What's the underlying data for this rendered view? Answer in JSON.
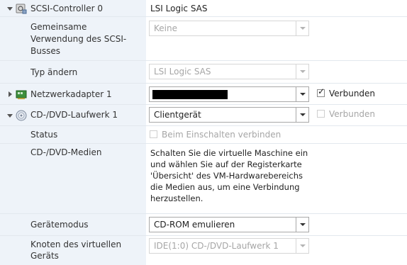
{
  "rows": {
    "scsi_controller": {
      "label": "SCSI-Controller 0",
      "value": "LSI Logic SAS"
    },
    "bus_sharing": {
      "label_lines": [
        "Gemeinsame",
        "Verwendung des SCSI-",
        "Busses"
      ],
      "select_value": "Keine"
    },
    "change_type": {
      "label": "Typ ändern",
      "select_value": "LSI Logic SAS"
    },
    "network_adapter": {
      "label": "Netzwerkadapter 1",
      "select_value": "",
      "connected_label": "Verbunden",
      "connected_checked": true
    },
    "cd_dvd_drive": {
      "label": "CD-/DVD-Laufwerk 1",
      "select_value": "Clientgerät",
      "connected_label": "Verbunden",
      "connected_checked": false
    },
    "status": {
      "label": "Status",
      "checkbox_label": "Beim Einschalten verbinden",
      "checked": false
    },
    "media": {
      "label": "CD-/DVD-Medien",
      "description_lines": [
        "Schalten Sie die virtuelle Maschine ein",
        "und wählen Sie auf der Registerkarte",
        "'Übersicht' des VM-Hardwarebereichs",
        "die Medien aus, um eine Verbindung",
        "herzustellen."
      ]
    },
    "device_mode": {
      "label": "Gerätemodus",
      "select_value": "CD-ROM emulieren"
    },
    "virtual_device_node": {
      "label_lines": [
        "Knoten des virtuellen",
        "Geräts"
      ],
      "select_value": "IDE(1:0) CD-/DVD-Laufwerk 1"
    }
  },
  "icons": {
    "scsi": "scsi-controller-icon",
    "network": "network-adapter-icon",
    "cd": "cd-dvd-drive-icon"
  },
  "colors": {
    "label_column_bg": "#eef3f9",
    "row_divider": "#e2e8ee",
    "disabled_text": "#a6a6a6"
  }
}
